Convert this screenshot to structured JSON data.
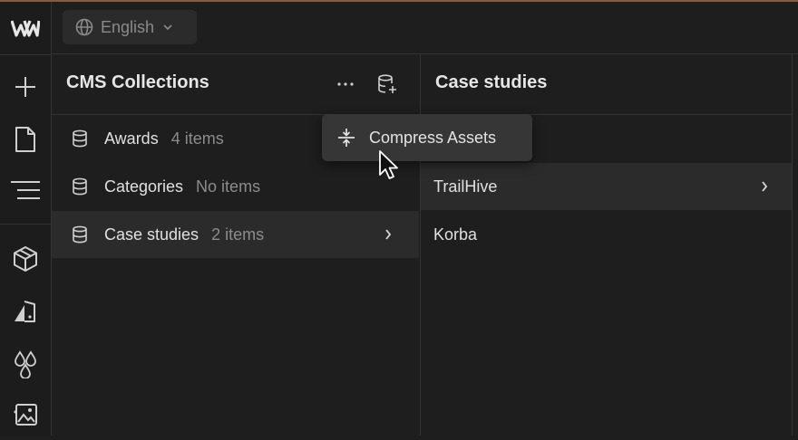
{
  "topbar": {
    "language": "English"
  },
  "collections_panel": {
    "title": "CMS Collections",
    "items": [
      {
        "name": "Awards",
        "count": "4 items"
      },
      {
        "name": "Categories",
        "count": "No items"
      },
      {
        "name": "Case studies",
        "count": "2 items",
        "selected": true
      }
    ]
  },
  "detail_panel": {
    "title": "Case studies",
    "items": [
      {
        "name": "TrailHive",
        "selected": true
      },
      {
        "name": "Korba"
      }
    ]
  },
  "dropdown": {
    "compress_label": "Compress Assets"
  },
  "icons": {
    "logo": "webflow-logo-icon",
    "rail": [
      "plus-icon",
      "page-icon",
      "navigator-icon",
      "components-icon",
      "style-icon",
      "colors-icon",
      "assets-icon"
    ]
  },
  "colors": {
    "background": "#1e1e1e",
    "selected_row": "#2b2b2b",
    "menu": "#363636",
    "accent_line": "#8a5a3a"
  }
}
